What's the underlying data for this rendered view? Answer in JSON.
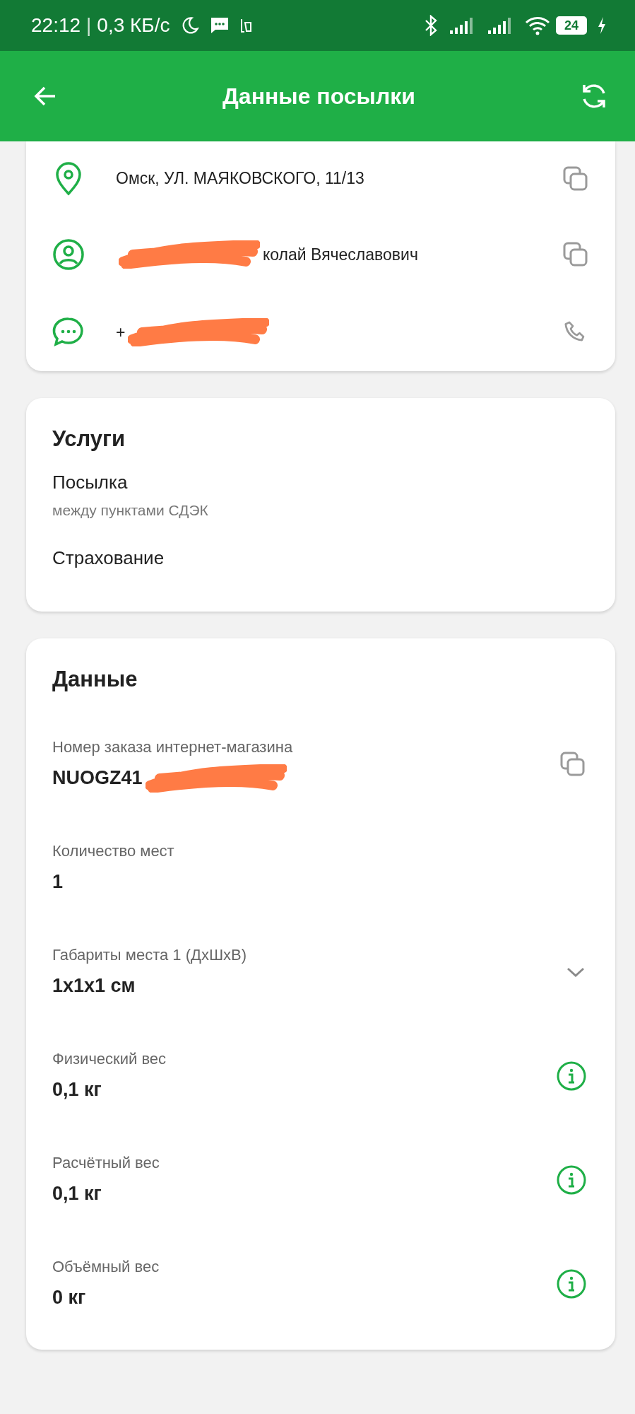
{
  "status_bar": {
    "time": "22:12",
    "separator": "|",
    "speed": "0,3 КБ/с",
    "battery": "24"
  },
  "app_bar": {
    "title": "Данные посылки"
  },
  "contacts": [
    {
      "kind": "address",
      "text": "Омск, УЛ. МАЯКОВСКОГО, 11/13",
      "copy": true,
      "call": false,
      "scribble_before": false,
      "scribble_after": false
    },
    {
      "kind": "person",
      "text": "колай Вячеславович",
      "copy": true,
      "call": false,
      "scribble_before": true,
      "scribble_after": false
    },
    {
      "kind": "chat",
      "text": "+",
      "copy": false,
      "call": true,
      "scribble_before": false,
      "scribble_after": true
    }
  ],
  "services": {
    "title": "Услуги",
    "items": [
      {
        "name": "Посылка",
        "note": "между пунктами СДЭК"
      },
      {
        "name": "Страхование"
      }
    ]
  },
  "details": {
    "title": "Данные",
    "rows": [
      {
        "label": "Номер заказа интернет-магазина",
        "value": "NUOGZ41",
        "copy": true,
        "expand": false,
        "info": false,
        "scribble_after": true
      },
      {
        "label": "Количество мест",
        "value": "1",
        "copy": false,
        "expand": false,
        "info": false,
        "scribble_after": false
      },
      {
        "label": "Габариты места 1 (ДхШхВ)",
        "value": "1x1x1 см",
        "copy": false,
        "expand": true,
        "info": false,
        "scribble_after": false
      },
      {
        "label": "Физический вес",
        "value": "0,1 кг",
        "copy": false,
        "expand": false,
        "info": true,
        "scribble_after": false
      },
      {
        "label": "Расчётный вес",
        "value": "0,1 кг",
        "copy": false,
        "expand": false,
        "info": true,
        "scribble_after": false
      },
      {
        "label": "Объёмный вес",
        "value": "0 кг",
        "copy": false,
        "expand": false,
        "info": true,
        "scribble_after": false
      }
    ]
  }
}
